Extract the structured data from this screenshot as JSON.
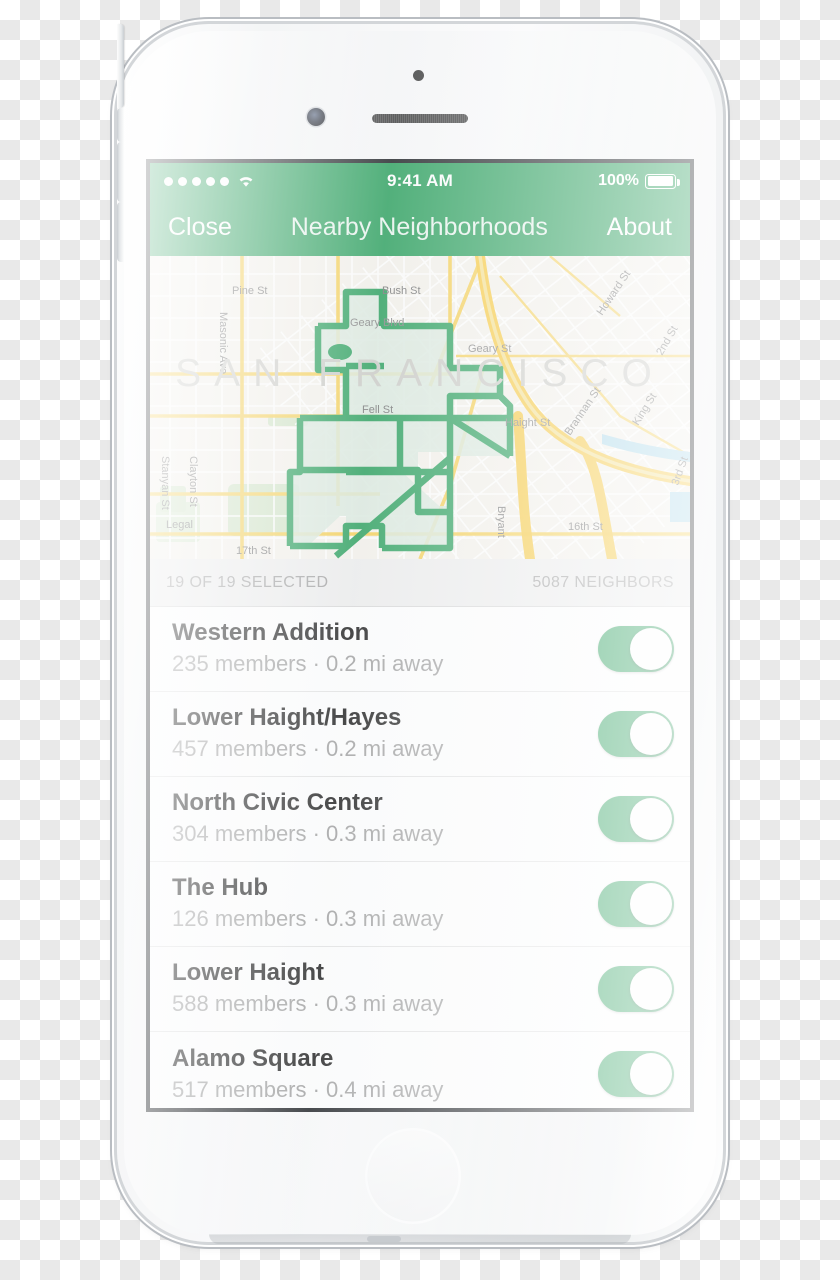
{
  "status_bar": {
    "signal_dots": 5,
    "wifi_icon": "wifi-icon",
    "time": "9:41 AM",
    "battery_percent": "100%",
    "battery_icon": "battery-full-icon"
  },
  "nav_bar": {
    "left_button": "Close",
    "title": "Nearby Neighborhoods",
    "right_button": "About"
  },
  "map": {
    "city_label": "SAN FRANCISCO",
    "outline_color": "#1f9b54",
    "fill_color": "#d7e8dc",
    "street_labels": [
      "Pine St",
      "Bush St",
      "Masonic Ave",
      "Geary Blvd",
      "Geary St",
      "Fell St",
      "Howard St",
      "Brannan St",
      "King St",
      "2nd St",
      "3rd St",
      "16th St",
      "17th St",
      "Bryant",
      "Clayton St",
      "Stanyan St",
      "Legal",
      "Haight St"
    ]
  },
  "section_header": {
    "selected_label": "19 OF 19 SELECTED",
    "neighbors_label": "5087 NEIGHBORS"
  },
  "neighborhoods": [
    {
      "name": "Western Addition",
      "detail": "235 members · 0.2 mi away",
      "enabled": true
    },
    {
      "name": "Lower Haight/Hayes",
      "detail": "457 members · 0.2 mi away",
      "enabled": true
    },
    {
      "name": "North Civic Center",
      "detail": "304 members · 0.3 mi away",
      "enabled": true
    },
    {
      "name": "The Hub",
      "detail": "126 members · 0.3 mi away",
      "enabled": true
    },
    {
      "name": "Lower Haight",
      "detail": "588 members · 0.3 mi away",
      "enabled": true
    },
    {
      "name": "Alamo Square",
      "detail": "517 members · 0.4 mi away",
      "enabled": true
    }
  ],
  "theme": {
    "accent_green": "#1f9b54",
    "header_gray": "#ededed",
    "subtitle_gray": "#9b9b9b"
  }
}
